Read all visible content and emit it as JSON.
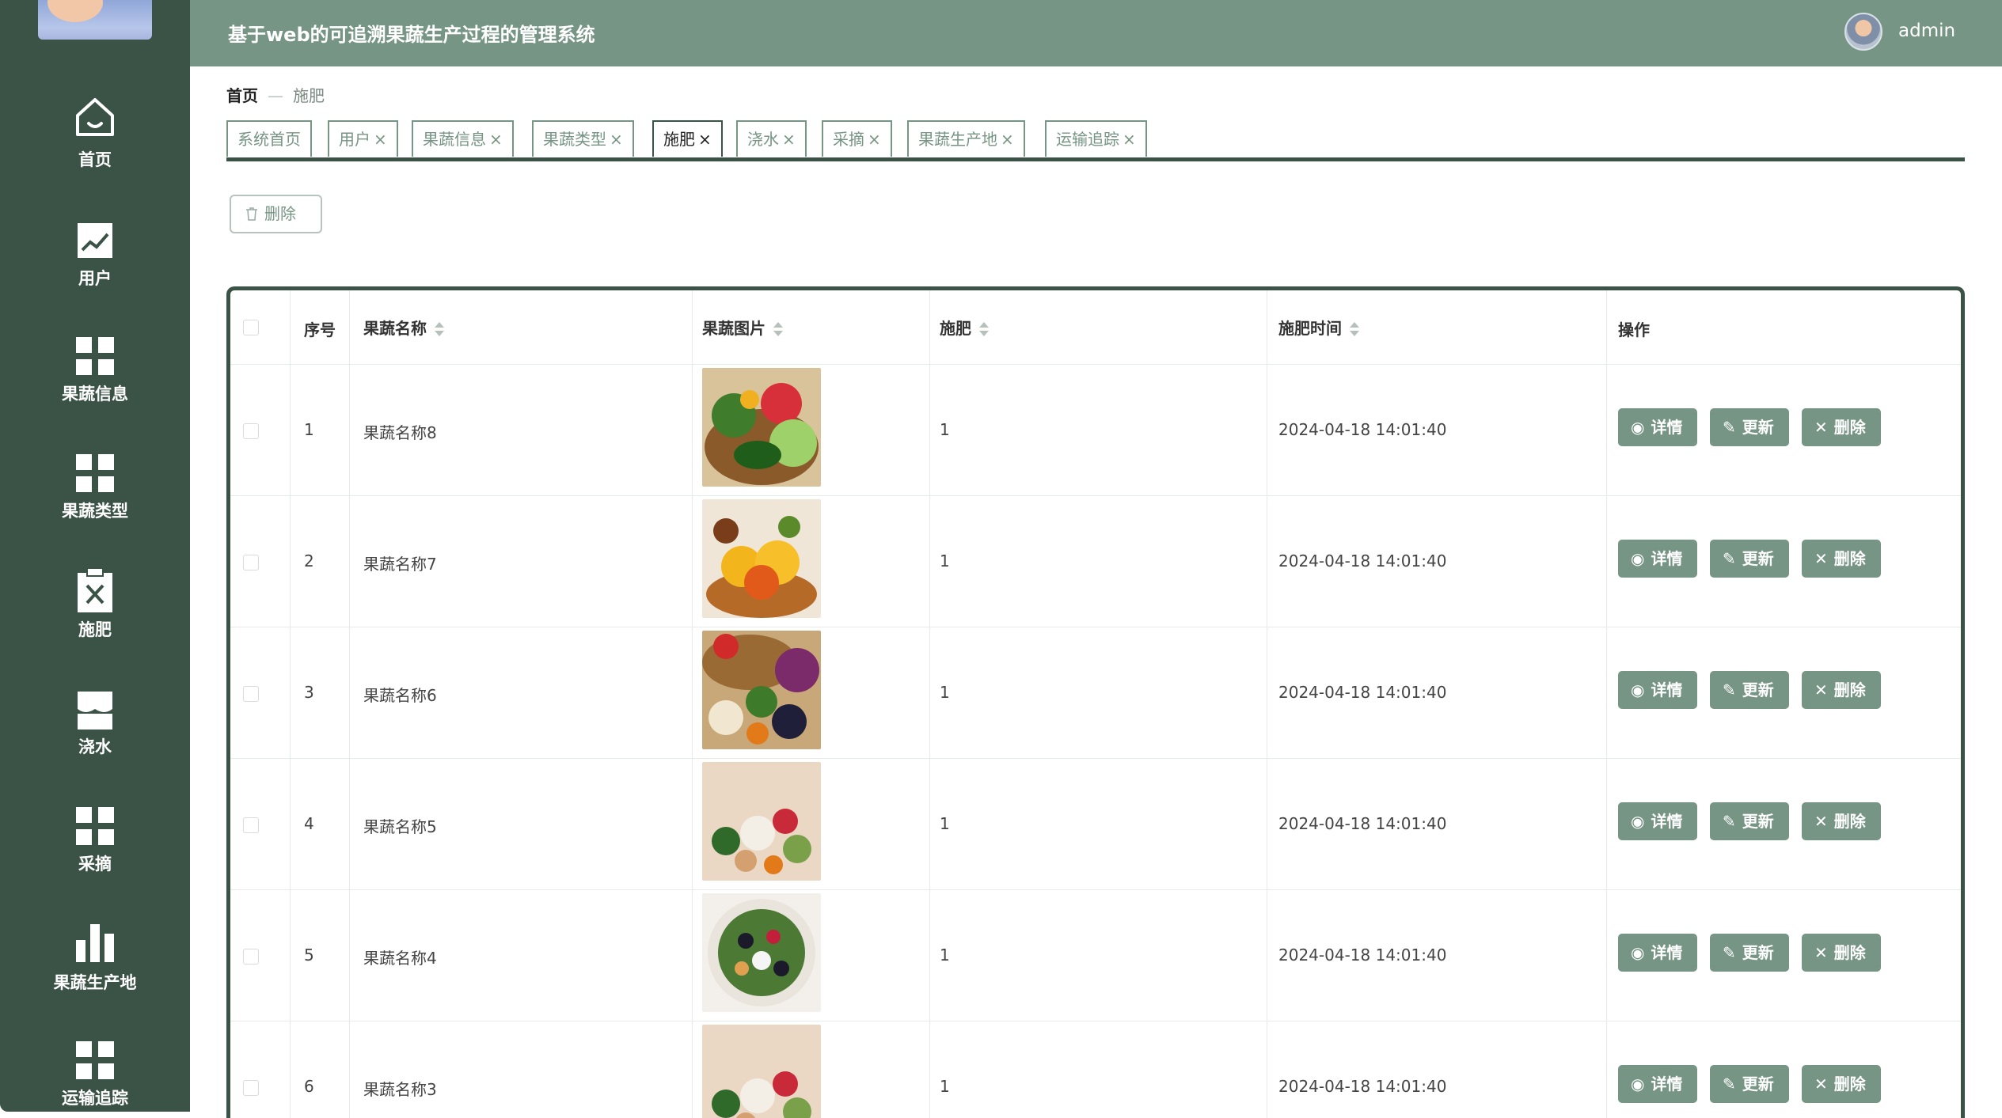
{
  "app": {
    "title": "基于web的可追溯果蔬生产过程的管理系统",
    "username": "admin"
  },
  "sidebar": {
    "items": [
      {
        "label": "首页",
        "icon": "home-icon"
      },
      {
        "label": "用户",
        "icon": "chart-line-icon"
      },
      {
        "label": "果蔬信息",
        "icon": "grid-icon"
      },
      {
        "label": "果蔬类型",
        "icon": "grid-icon"
      },
      {
        "label": "施肥",
        "icon": "clipboard-x-icon"
      },
      {
        "label": "浇水",
        "icon": "shop-icon"
      },
      {
        "label": "采摘",
        "icon": "grid-icon"
      },
      {
        "label": "果蔬生产地",
        "icon": "bar-chart-icon"
      },
      {
        "label": "运输追踪",
        "icon": "grid-icon"
      }
    ]
  },
  "breadcrumb": {
    "home": "首页",
    "sep": "—",
    "current": "施肥"
  },
  "tabs": [
    {
      "label": "系统首页",
      "closable": false
    },
    {
      "label": "用户",
      "closable": true
    },
    {
      "label": "果蔬信息",
      "closable": true
    },
    {
      "label": "果蔬类型",
      "closable": true
    },
    {
      "label": "施肥",
      "closable": true,
      "active": true
    },
    {
      "label": "浇水",
      "closable": true
    },
    {
      "label": "采摘",
      "closable": true
    },
    {
      "label": "果蔬生产地",
      "closable": true
    },
    {
      "label": "运输追踪",
      "closable": true
    }
  ],
  "toolbar": {
    "delete_label": "删除"
  },
  "table": {
    "headers": {
      "index": "序号",
      "name": "果蔬名称",
      "image": "果蔬图片",
      "fertilize": "施肥",
      "time": "施肥时间",
      "actions": "操作"
    },
    "rows": [
      {
        "index": "1",
        "name": "果蔬名称8",
        "fertilize": "1",
        "time": "2024-04-18 14:01:40"
      },
      {
        "index": "2",
        "name": "果蔬名称7",
        "fertilize": "1",
        "time": "2024-04-18 14:01:40"
      },
      {
        "index": "3",
        "name": "果蔬名称6",
        "fertilize": "1",
        "time": "2024-04-18 14:01:40"
      },
      {
        "index": "4",
        "name": "果蔬名称5",
        "fertilize": "1",
        "time": "2024-04-18 14:01:40"
      },
      {
        "index": "5",
        "name": "果蔬名称4",
        "fertilize": "1",
        "time": "2024-04-18 14:01:40"
      },
      {
        "index": "6",
        "name": "果蔬名称3",
        "fertilize": "1",
        "time": "2024-04-18 14:01:40"
      }
    ],
    "actions": {
      "detail": "详情",
      "update": "更新",
      "delete": "删除"
    }
  },
  "colors": {
    "sidebar": "#3b5346",
    "header": "#769585",
    "accent": "#769585"
  }
}
